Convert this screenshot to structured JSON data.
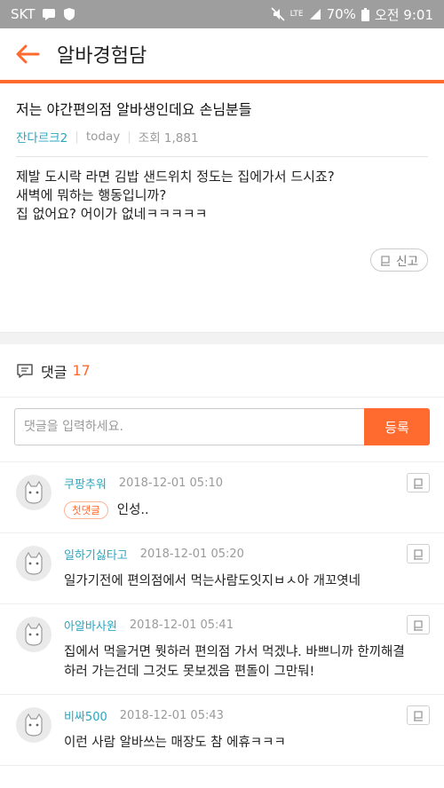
{
  "status_bar": {
    "carrier": "SKT",
    "network": "LTE",
    "battery": "70%",
    "time": "오전 9:01"
  },
  "header": {
    "title": "알바경험담"
  },
  "post": {
    "title": "저는 야간편의점 알바생인데요 손님분들",
    "author": "잔다르크2",
    "date": "today",
    "views": "조회 1,881",
    "body_lines": [
      "제발 도시락 라면 김밥 샌드위치 정도는 집에가서 드시죠?",
      "새벽에 뭐하는 행동입니까?",
      "집 없어요? 어이가 없네ㅋㅋㅋㅋㅋ"
    ],
    "report_label": "신고"
  },
  "comments_section": {
    "label": "댓글",
    "count": "17",
    "input_placeholder": "댓글을 입력하세요.",
    "submit_label": "등록"
  },
  "comments": [
    {
      "author": "쿠팡추워",
      "time": "2018-12-01 05:10",
      "badge": "첫댓글",
      "lines": [
        "인성.."
      ]
    },
    {
      "author": "일하기싫타고",
      "time": "2018-12-01 05:20",
      "badge": "",
      "lines": [
        "일가기전에 편의점에서 먹는사람도잇지ㅂㅅ아 개꼬엿네"
      ]
    },
    {
      "author": "아알바사원",
      "time": "2018-12-01 05:41",
      "badge": "",
      "lines": [
        "집에서 먹을거면 뭣하러 편의점 가서 먹겠냐. 바쁘니까 한끼해결",
        "하러 가는건데 그것도 못보겠음 편돌이 그만둬!"
      ]
    },
    {
      "author": "비싸500",
      "time": "2018-12-01 05:43",
      "badge": "",
      "lines": [
        "이런 사람 알바쓰는 매장도 참 에휴ㅋㅋㅋ"
      ]
    }
  ],
  "colors": {
    "accent": "#ff6a2f",
    "author": "#2aa6bf",
    "status_bar": "#9e9e9e"
  },
  "icons": [
    "back-arrow-icon",
    "flag-icon",
    "comment-icon",
    "cat-avatar-icon"
  ]
}
